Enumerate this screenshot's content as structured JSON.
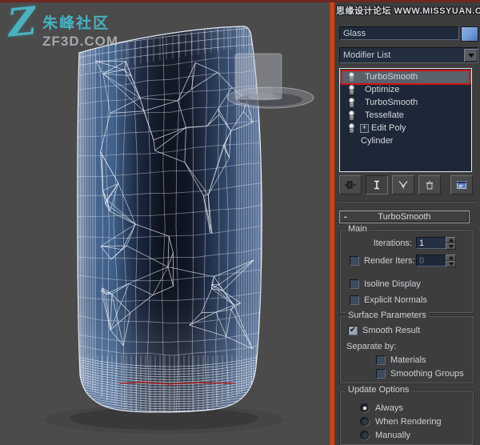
{
  "ui": {
    "check_glyph": "✔",
    "collapse_glyph": "-",
    "expand_glyph": "+"
  },
  "watermarks": {
    "logo_z": "Z",
    "logo_title": "朱峰社区",
    "logo_subtitle": "ZF3D.COM",
    "forum": "思缘设计论坛 WWW.MISSYUAN.COM"
  },
  "panel": {
    "object_name": "Glass",
    "modifier_list_label": "Modifier List",
    "stack": [
      {
        "label": "TurboSmooth",
        "bulb": true,
        "selected": true,
        "highlighted": true
      },
      {
        "label": "Optimize",
        "bulb": true
      },
      {
        "label": "TurboSmooth",
        "bulb": true
      },
      {
        "label": "Tessellate",
        "bulb": true
      },
      {
        "label": "Edit Poly",
        "bulb": true,
        "expandable": true
      },
      {
        "label": "Cylinder",
        "bulb": false
      }
    ],
    "stack_toolbar_icons": [
      "pin-stack-icon",
      "show-end-result-icon",
      "make-unique-icon",
      "remove-modifier-icon",
      "configure-modifier-sets-icon"
    ],
    "rollout": {
      "title": "TurboSmooth",
      "main": {
        "label": "Main",
        "iterations_label": "Iterations:",
        "iterations_value": "1",
        "render_iters_label": "Render Iters:",
        "render_iters_value": "0",
        "render_iters_checked": false,
        "isoline_display_label": "Isoline Display",
        "isoline_checked": false,
        "explicit_normals_label": "Explicit Normals",
        "explicit_checked": false
      },
      "surface": {
        "label": "Surface Parameters",
        "smooth_result_label": "Smooth Result",
        "smooth_result_checked": true,
        "separate_by_label": "Separate by:",
        "materials_label": "Materials",
        "materials_checked": false,
        "smoothing_groups_label": "Smoothing Groups",
        "smoothing_groups_checked": false
      },
      "update": {
        "label": "Update Options",
        "options": [
          "Always",
          "When Rendering",
          "Manually"
        ],
        "selected": "Always"
      }
    }
  },
  "colors": {
    "highlight_red": "#d21414",
    "viewport_border": "#c8441f",
    "swatch_blue": "#6f9ad8",
    "wireframe": "#e9eef6",
    "selected_edge_red": "#b22018",
    "logo_cyan": "#4cc3d4",
    "stack_bg": "#1d2737",
    "panel_bg": "#3d3d3d",
    "viewport_bg": "#4b4b4b"
  }
}
